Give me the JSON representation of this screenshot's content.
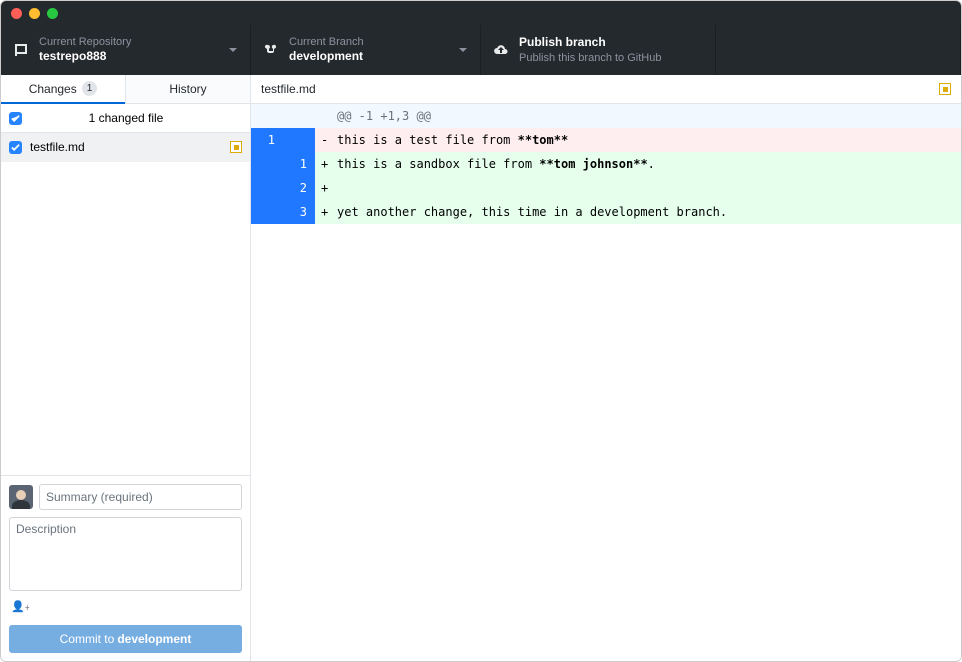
{
  "toolbar": {
    "repo_label": "Current Repository",
    "repo_name": "testrepo888",
    "branch_label": "Current Branch",
    "branch_name": "development",
    "publish_title": "Publish branch",
    "publish_hint": "Publish this branch to GitHub"
  },
  "tabs": {
    "changes_label": "Changes",
    "changes_count": "1",
    "history_label": "History"
  },
  "changes": {
    "header_label": "1 changed file",
    "files": [
      {
        "name": "testfile.md",
        "status": "modified",
        "checked": true
      }
    ]
  },
  "commit_form": {
    "summary_placeholder": "Summary (required)",
    "description_placeholder": "Description",
    "coauthor_glyph": "👤﹢",
    "button_prefix": "Commit to ",
    "button_branch": "development"
  },
  "file_view": {
    "filename": "testfile.md",
    "status": "modified"
  },
  "diff": {
    "hunk_header": "@@ -1 +1,3 @@",
    "lines": [
      {
        "type": "del",
        "old": "1",
        "new": "",
        "sign": "-",
        "text_pre": "this is a test file from ",
        "bold": "**tom**",
        "text_post": ""
      },
      {
        "type": "add",
        "old": "",
        "new": "1",
        "sign": "+",
        "text_pre": "this is a sandbox file from ",
        "bold": "**tom johnson**",
        "text_post": "."
      },
      {
        "type": "add",
        "old": "",
        "new": "2",
        "sign": "+",
        "text_pre": "",
        "bold": "",
        "text_post": ""
      },
      {
        "type": "add",
        "old": "",
        "new": "3",
        "sign": "+",
        "text_pre": "yet another change, this time in a development branch.",
        "bold": "",
        "text_post": ""
      }
    ]
  }
}
